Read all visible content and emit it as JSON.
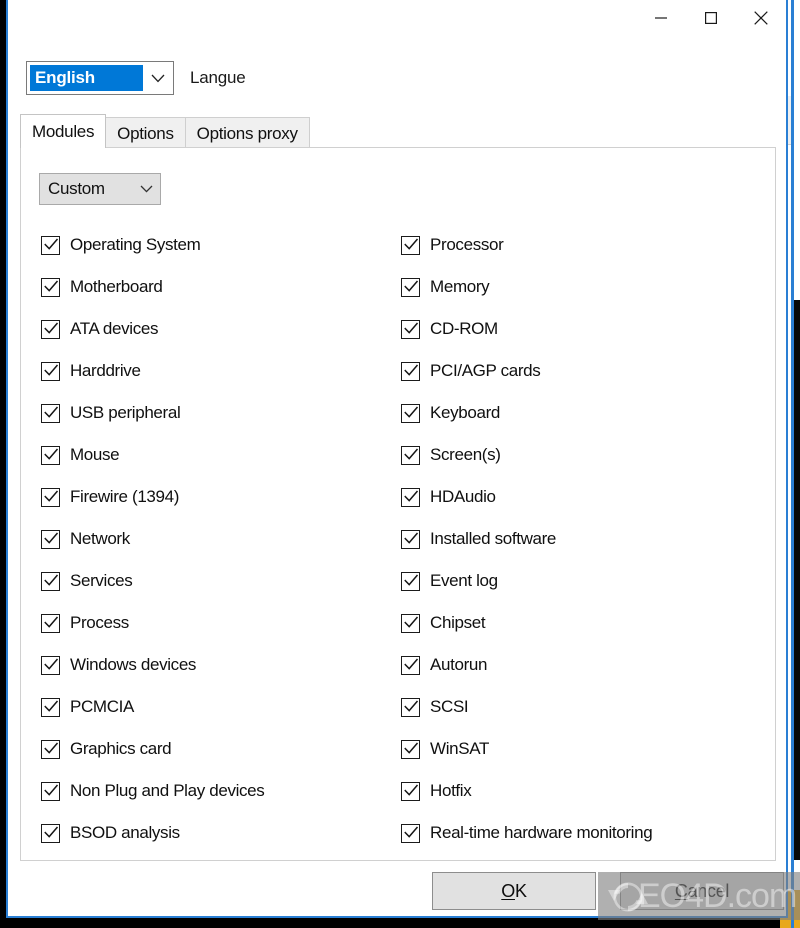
{
  "window": {
    "controls": {
      "minimize_label": "Minimize",
      "maximize_label": "Maximize",
      "close_label": "Close"
    }
  },
  "language": {
    "selected": "English",
    "label": "Langue"
  },
  "tabs": [
    {
      "label": "Modules",
      "active": true
    },
    {
      "label": "Options",
      "active": false
    },
    {
      "label": "Options proxy",
      "active": false
    }
  ],
  "preset": {
    "selected": "Custom"
  },
  "modules": {
    "left_column": [
      {
        "label": "Operating System",
        "checked": true
      },
      {
        "label": "Motherboard",
        "checked": true
      },
      {
        "label": "ATA devices",
        "checked": true
      },
      {
        "label": "Harddrive",
        "checked": true
      },
      {
        "label": "USB peripheral",
        "checked": true
      },
      {
        "label": "Mouse",
        "checked": true
      },
      {
        "label": "Firewire (1394)",
        "checked": true
      },
      {
        "label": "Network",
        "checked": true
      },
      {
        "label": "Services",
        "checked": true
      },
      {
        "label": "Process",
        "checked": true
      },
      {
        "label": "Windows devices",
        "checked": true
      },
      {
        "label": "PCMCIA",
        "checked": true
      },
      {
        "label": "Graphics card",
        "checked": true
      },
      {
        "label": "Non Plug and Play devices",
        "checked": true
      },
      {
        "label": "BSOD analysis",
        "checked": true
      }
    ],
    "right_column": [
      {
        "label": "Processor",
        "checked": true
      },
      {
        "label": "Memory",
        "checked": true
      },
      {
        "label": "CD-ROM",
        "checked": true
      },
      {
        "label": "PCI/AGP cards",
        "checked": true
      },
      {
        "label": "Keyboard",
        "checked": true
      },
      {
        "label": "Screen(s)",
        "checked": true
      },
      {
        "label": "HDAudio",
        "checked": true
      },
      {
        "label": "Installed software",
        "checked": true
      },
      {
        "label": "Event log",
        "checked": true
      },
      {
        "label": "Chipset",
        "checked": true
      },
      {
        "label": "Autorun",
        "checked": true
      },
      {
        "label": "SCSI",
        "checked": true
      },
      {
        "label": "WinSAT",
        "checked": true
      },
      {
        "label": "Hotfix",
        "checked": true
      },
      {
        "label": "Real-time hardware monitoring",
        "checked": true
      }
    ]
  },
  "footer": {
    "ok_label": "OK",
    "ok_accel": "O",
    "ok_rest": "K",
    "cancel_label": "Cancel",
    "cancel_accel": "C",
    "cancel_rest": "ancel"
  },
  "watermark": {
    "text": "EO4D.com"
  },
  "colors": {
    "accent": "#0078d7",
    "window_border": "#2a7fd4",
    "button_face": "#e1e1e1",
    "tab_inactive": "#f0f0f0",
    "text": "#101010"
  }
}
